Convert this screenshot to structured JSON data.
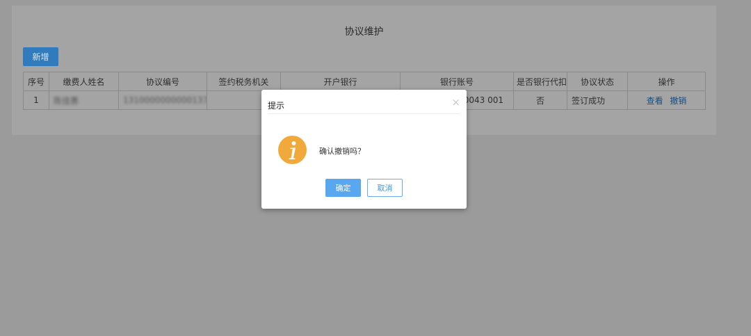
{
  "page": {
    "title": "协议维护"
  },
  "toolbar": {
    "add_label": "新增"
  },
  "table": {
    "headers": [
      "序号",
      "缴费人姓名",
      "协议编号",
      "签约税务机关",
      "开户银行",
      "银行账号",
      "是否银行代扣",
      "协议状态",
      "操作"
    ],
    "rows": [
      {
        "index": "1",
        "payer_name": "陈佳惠",
        "agreement_no": "1310000000000137 .",
        "tax_office": "",
        "bank": "",
        "account": "0043 001",
        "bank_deduct": "否",
        "status": "签订成功",
        "view_label": "查看",
        "revoke_label": "撤销"
      }
    ]
  },
  "dialog": {
    "title": "提示",
    "close_symbol": "×",
    "icon": "info-circle-icon",
    "message": "确认撤销吗？",
    "ok_label": "确定",
    "cancel_label": "取消"
  },
  "colors": {
    "overlay": "#9b9b9b",
    "panel": "#a4a4a4",
    "primary": "#59a7ee",
    "info_icon": "#f2a93b",
    "link": "#134f86"
  }
}
